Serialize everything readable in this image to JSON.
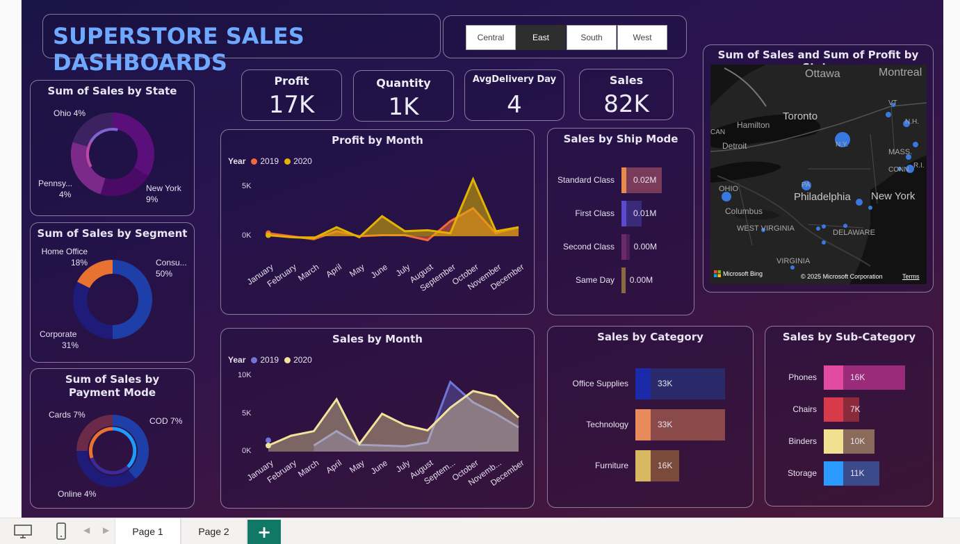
{
  "header": {
    "title": "SUPERSTORE SALES DASHBOARDS"
  },
  "slicer": {
    "options": [
      "Central",
      "East",
      "South",
      "West"
    ],
    "selected": "East"
  },
  "kpis": [
    {
      "title": "Profit",
      "value": "17K"
    },
    {
      "title": "Quantity",
      "value": "1K"
    },
    {
      "title": "AvgDelivery Day",
      "value": "4"
    },
    {
      "title": "Sales",
      "value": "82K"
    }
  ],
  "sales_by_state": {
    "title": "Sum of Sales by State",
    "labels": [
      {
        "name": "Ohio",
        "pct": "4%"
      },
      {
        "name": "Pennsy...",
        "pct": "4%"
      },
      {
        "name": "New York",
        "pct": "9%"
      }
    ]
  },
  "sales_by_segment": {
    "title": "Sum of Sales by Segment",
    "labels": [
      {
        "name": "Home Office",
        "pct": "18%"
      },
      {
        "name": "Consu...",
        "pct": "50%"
      },
      {
        "name": "Corporate",
        "pct": "31%"
      }
    ]
  },
  "sales_by_payment": {
    "title": "Sum of Sales by Payment Mode",
    "labels": [
      {
        "name": "Cards",
        "pct": "7%"
      },
      {
        "name": "COD",
        "pct": "7%"
      },
      {
        "name": "Online",
        "pct": "4%"
      }
    ]
  },
  "profit_by_month": {
    "title": "Profit by Month",
    "legend_title": "Year",
    "legend": [
      "2019",
      "2020"
    ],
    "yticks": [
      "5K",
      "0K"
    ]
  },
  "sales_by_month": {
    "title": "Sales by Month",
    "legend_title": "Year",
    "legend": [
      "2019",
      "2020"
    ],
    "yticks": [
      "10K",
      "5K",
      "0K"
    ]
  },
  "ship_mode": {
    "title": "Sales by Ship Mode",
    "rows": [
      {
        "label": "Standard Class",
        "value": "0.02M"
      },
      {
        "label": "First Class",
        "value": "0.01M"
      },
      {
        "label": "Second Class",
        "value": "0.00M"
      },
      {
        "label": "Same Day",
        "value": "0.00M"
      }
    ]
  },
  "map_panel": {
    "title": "Sum of Sales and Sum of Profit by State",
    "labels": [
      "Ottawa",
      "Montreal",
      "Toronto",
      "Hamilton",
      "Detroit",
      "Philadelphia",
      "New York",
      "Columbus",
      "WEST VIRGINIA",
      "VIRGINIA",
      "DELAWARE",
      "OHIO",
      "N.Y.",
      "PA",
      "VT",
      "N.H.",
      "MASS.",
      "CONN.",
      "R.I.",
      "CAN"
    ],
    "bing": "Microsoft Bing",
    "copyright": "© 2025 Microsoft Corporation",
    "terms": "Terms"
  },
  "category": {
    "title": "Sales by Category",
    "rows": [
      {
        "label": "Office Supplies",
        "value": "33K"
      },
      {
        "label": "Technology",
        "value": "33K"
      },
      {
        "label": "Furniture",
        "value": "16K"
      }
    ]
  },
  "subcategory": {
    "title": "Sales by Sub-Category",
    "rows": [
      {
        "label": "Phones",
        "value": "16K"
      },
      {
        "label": "Chairs",
        "value": "7K"
      },
      {
        "label": "Binders",
        "value": "10K"
      },
      {
        "label": "Storage",
        "value": "11K"
      }
    ]
  },
  "pages": {
    "tabs": [
      "Page 1",
      "Page 2"
    ],
    "add": "+"
  },
  "colors": {
    "title_blue": "#6fa8ff",
    "profit_2019": "#f06a3a",
    "profit_2020": "#e0b400",
    "sales_2019": "#6f76d8",
    "sales_2020": "#f3e39a"
  },
  "chart_data": [
    {
      "type": "area",
      "title": "Profit by Month",
      "categories": [
        "January",
        "February",
        "March",
        "April",
        "May",
        "June",
        "July",
        "August",
        "September",
        "October",
        "November",
        "December"
      ],
      "series": [
        {
          "name": "2019",
          "values": [
            300,
            0,
            -300,
            500,
            0,
            100,
            100,
            -400,
            1500,
            2800,
            300,
            900
          ]
        },
        {
          "name": "2020",
          "values": [
            100,
            -100,
            -200,
            900,
            -100,
            2000,
            500,
            600,
            300,
            5700,
            500,
            900
          ]
        }
      ],
      "yticks": [
        "5K",
        "0K"
      ]
    },
    {
      "type": "area",
      "title": "Sales by Month",
      "categories": [
        "January",
        "February",
        "March",
        "April",
        "May",
        "June",
        "July",
        "August",
        "Septem...",
        "October",
        "Novemb...",
        "December"
      ],
      "series": [
        {
          "name": "2019",
          "values": [
            1500,
            null,
            800,
            2700,
            900,
            800,
            700,
            1200,
            9200,
            6500,
            5000,
            3200
          ]
        },
        {
          "name": "2020",
          "values": [
            800,
            2100,
            2700,
            6900,
            1000,
            5000,
            3500,
            2800,
            5800,
            8000,
            7300,
            4500
          ]
        }
      ],
      "ylim": [
        0,
        10000
      ],
      "yticks": [
        "10K",
        "5K",
        "0K"
      ]
    },
    {
      "type": "bar",
      "title": "Sales by Ship Mode",
      "categories": [
        "Standard Class",
        "First Class",
        "Second Class",
        "Same Day"
      ],
      "values": [
        0.02,
        0.01,
        0.004,
        0.002
      ]
    },
    {
      "type": "bar",
      "title": "Sales by Category",
      "categories": [
        "Office Supplies",
        "Technology",
        "Furniture"
      ],
      "values": [
        33,
        33,
        16
      ]
    },
    {
      "type": "bar",
      "title": "Sales by Sub-Category",
      "categories": [
        "Phones",
        "Chairs",
        "Binders",
        "Storage"
      ],
      "values": [
        16,
        7,
        10,
        11
      ]
    }
  ]
}
